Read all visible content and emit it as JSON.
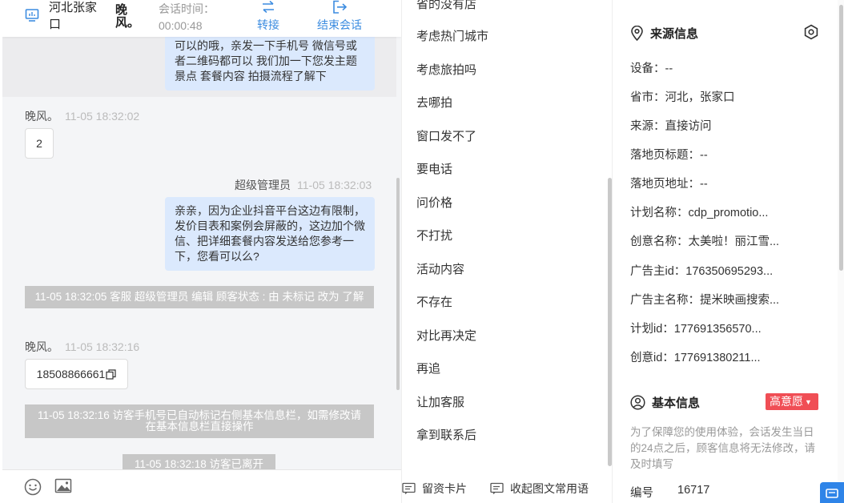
{
  "header": {
    "region": "河北张家口",
    "visitor_name": "晚风。",
    "session_time_label": "会话时间：",
    "session_time_value": "00:00:48",
    "transfer_label": "转接",
    "end_label": "结束会话"
  },
  "messages": {
    "m1_text": "可以的哦，亲发一下手机号 微信号或者二维码都可以 我们加一下您发主题景点 套餐内容 拍摄流程了解下",
    "m2_sender": "晚风。",
    "m2_time": "11-05 18:32:02",
    "m2_text": "2",
    "m3_sender": "超级管理员",
    "m3_time": "11-05 18:32:03",
    "m3_text": "亲亲，因为企业抖音平台这边有限制，发价目表和案例会屏蔽的，这边加个微信、把详细套餐内容发送给您参考一下，您看可以么?",
    "sys1": "11-05 18:32:05 客服 超级管理员 编辑 顾客状态 : 由 未标记 改为 了解",
    "m4_sender": "晚风。",
    "m4_time": "11-05 18:32:16",
    "m4_text": "18508866661",
    "sys2": "11-05 18:32:16 访客手机号已自动标记右侧基本信息栏，如需修改请在基本信息栏直接操作",
    "sys3": "11-05 18:32:18 访客已离开"
  },
  "quick_replies": {
    "items": [
      "省的没有店",
      "考虑热门城市",
      "考虑旅拍吗",
      "去哪拍",
      "窗口发不了",
      "要电话",
      "问价格",
      "不打扰",
      "活动内容",
      "不存在",
      "对比再决定",
      "再追",
      "让加客服",
      "拿到联系后"
    ],
    "footer_card": "留资卡片",
    "footer_collect": "收起图文常用语"
  },
  "source_info": {
    "title": "来源信息",
    "rows": [
      "设备：--",
      "省市：河北，张家口",
      "来源：直接访问",
      "落地页标题：--",
      "落地页地址：--",
      "计划名称：cdp_promotio...",
      "创意名称：太美啦！丽江雪...",
      "广告主id：176350695293...",
      "广告主名称：提米映画搜索...",
      "计划id：177691356570...",
      "创意id：177691380211..."
    ]
  },
  "basic_info": {
    "title": "基本信息",
    "intent": "高意愿",
    "hint": "为了保障您的使用体验，会话发生当日的24点之后，顾客信息将无法修改，请及时填写",
    "field_label": "编号",
    "field_value": "16717"
  },
  "colors": {
    "accent": "#3c8ce0",
    "bubble_out": "#dbe9fd",
    "system_msg": "#c7c7c7",
    "intent_badge": "#f04e55"
  }
}
